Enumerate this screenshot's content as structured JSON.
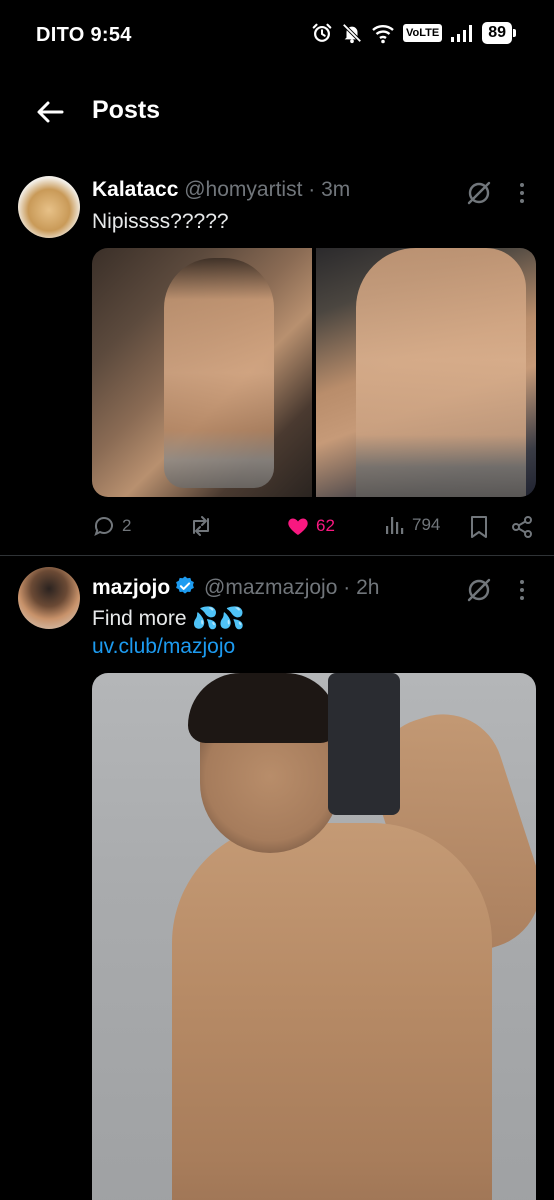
{
  "status_bar": {
    "carrier_time": "DITO 9:54",
    "volte": "VoLTE",
    "battery": "89"
  },
  "header": {
    "title": "Posts"
  },
  "posts": [
    {
      "display_name": "Kalatacc",
      "handle": "@homyartist",
      "separator": "·",
      "time": "3m",
      "text": "Nipissss?????",
      "media_count": 2,
      "actions": {
        "replies": "2",
        "reposts": "",
        "likes": "62",
        "views": "794"
      },
      "liked": true
    },
    {
      "display_name": "mazjojo",
      "verified": true,
      "handle": "@mazmazjojo",
      "separator": "·",
      "time": "2h",
      "text": "Find more 💦💦",
      "link": "uv.club/mazjojo",
      "media_count": 1
    }
  ],
  "colors": {
    "background": "#000000",
    "text_primary": "#e7e9ea",
    "text_secondary": "#71767b",
    "link": "#1d9bf0",
    "like": "#f91880",
    "verified": "#1d9bf0",
    "divider": "#2f3336"
  }
}
